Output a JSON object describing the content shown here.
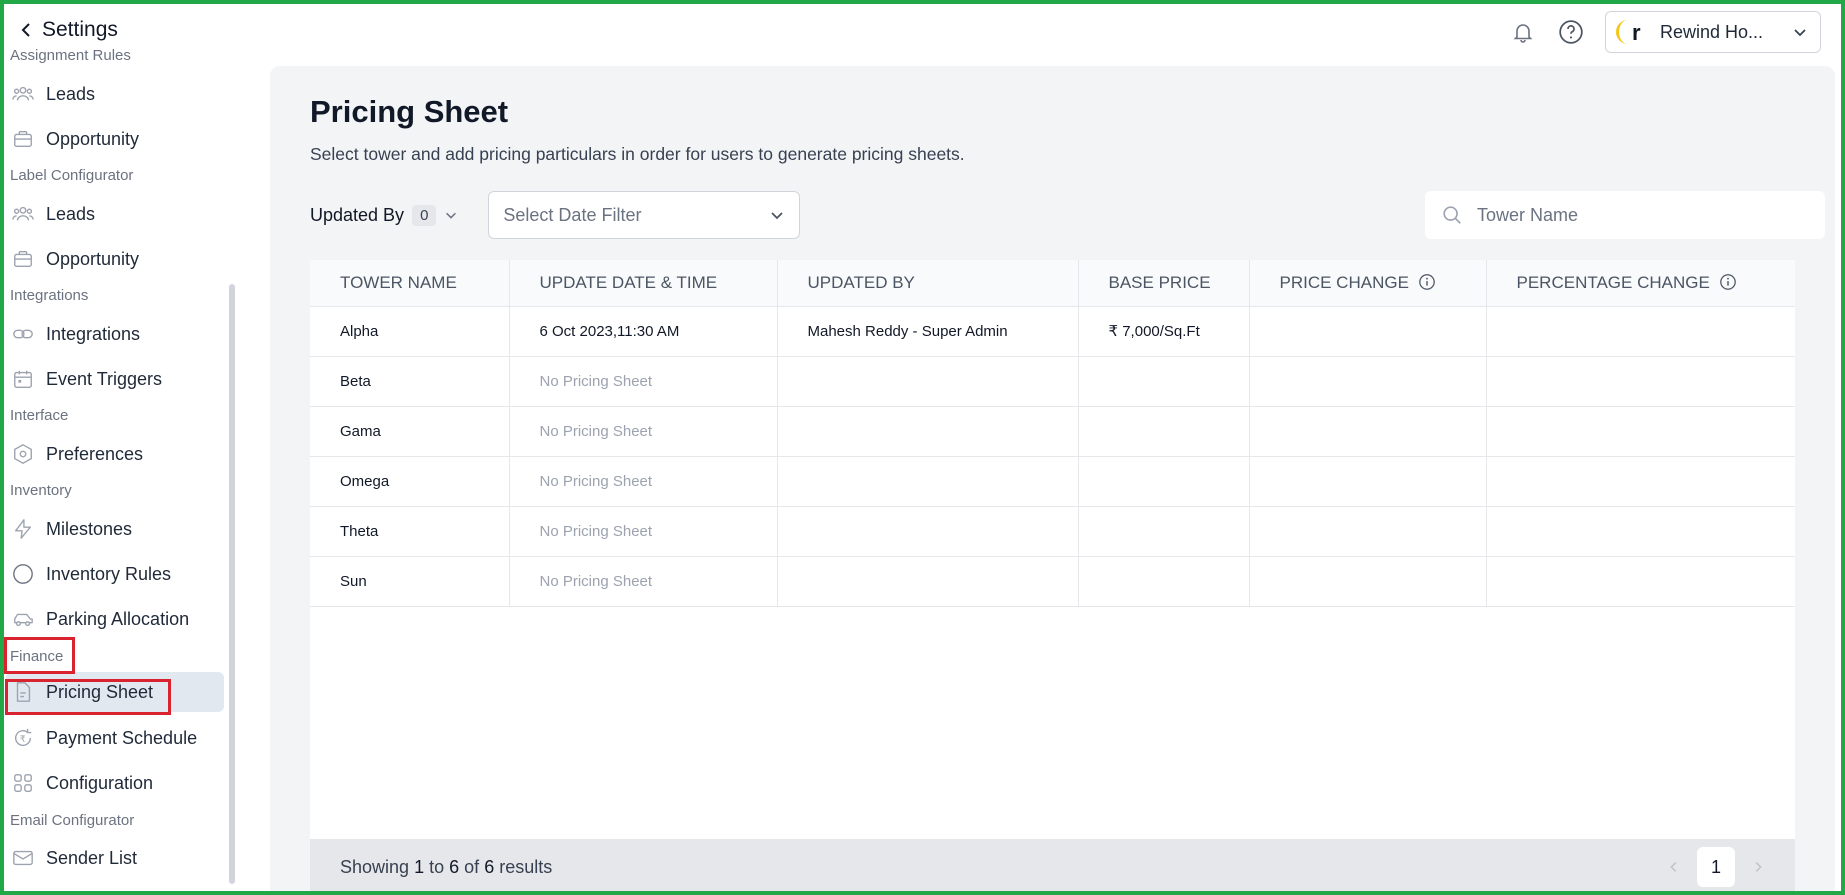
{
  "header": {
    "back_label": "Settings",
    "org_name": "Rewind Ho...",
    "logo_letter": "r"
  },
  "sidebar": {
    "sections": [
      {
        "label": "Assignment Rules",
        "items": [
          {
            "label": "Leads",
            "icon": "users-icon"
          },
          {
            "label": "Opportunity",
            "icon": "briefcase-icon"
          }
        ]
      },
      {
        "label": "Label Configurator",
        "items": [
          {
            "label": "Leads",
            "icon": "users-icon"
          },
          {
            "label": "Opportunity",
            "icon": "briefcase-icon"
          }
        ]
      },
      {
        "label": "Integrations",
        "items": [
          {
            "label": "Integrations",
            "icon": "link-icon"
          },
          {
            "label": "Event Triggers",
            "icon": "calendar-icon"
          }
        ]
      },
      {
        "label": "Interface",
        "items": [
          {
            "label": "Preferences",
            "icon": "hexagon-gear-icon"
          }
        ]
      },
      {
        "label": "Inventory",
        "items": [
          {
            "label": "Milestones",
            "icon": "bolt-icon"
          },
          {
            "label": "Inventory Rules",
            "icon": "circle-icon"
          },
          {
            "label": "Parking Allocation",
            "icon": "car-icon"
          }
        ]
      },
      {
        "label": "Finance",
        "items": [
          {
            "label": "Pricing Sheet",
            "icon": "document-icon",
            "active": true
          },
          {
            "label": "Payment Schedule",
            "icon": "rupee-cycle-icon"
          },
          {
            "label": "Configuration",
            "icon": "grid-icon"
          }
        ]
      },
      {
        "label": "Email Configurator",
        "items": [
          {
            "label": "Sender List",
            "icon": "mail-icon"
          }
        ]
      }
    ]
  },
  "main": {
    "title": "Pricing Sheet",
    "subtitle": "Select tower and add pricing particulars in order for users to generate pricing sheets.",
    "updated_by_label": "Updated By",
    "updated_by_count": "0",
    "date_filter_placeholder": "Select Date Filter",
    "search_placeholder": "Tower Name",
    "columns": [
      "Tower Name",
      "Update Date & Time",
      "Updated By",
      "Base Price",
      "Price Change",
      "Percentage Change"
    ],
    "rows": [
      {
        "tower": "Alpha",
        "date": "6 Oct 2023,11:30 AM",
        "updated_by": "Mahesh Reddy - Super Admin",
        "base_price": "₹ 7,000/Sq.Ft",
        "price_change": "",
        "pct_change": ""
      },
      {
        "tower": "Beta",
        "date": "No Pricing Sheet",
        "updated_by": "",
        "base_price": "",
        "price_change": "",
        "pct_change": ""
      },
      {
        "tower": "Gama",
        "date": "No Pricing Sheet",
        "updated_by": "",
        "base_price": "",
        "price_change": "",
        "pct_change": ""
      },
      {
        "tower": "Omega",
        "date": "No Pricing Sheet",
        "updated_by": "",
        "base_price": "",
        "price_change": "",
        "pct_change": ""
      },
      {
        "tower": "Theta",
        "date": "No Pricing Sheet",
        "updated_by": "",
        "base_price": "",
        "price_change": "",
        "pct_change": ""
      },
      {
        "tower": "Sun",
        "date": "No Pricing Sheet",
        "updated_by": "",
        "base_price": "",
        "price_change": "",
        "pct_change": ""
      }
    ],
    "footer": {
      "showing_prefix": "Showing",
      "from": "1",
      "to_word": "to",
      "to": "6",
      "of_word": "of",
      "total": "6",
      "results_word": "results",
      "current_page": "1"
    }
  },
  "colors": {
    "frame": "#22a846",
    "highlight": "#d9242f",
    "logo_yellow": "#f5c518"
  }
}
